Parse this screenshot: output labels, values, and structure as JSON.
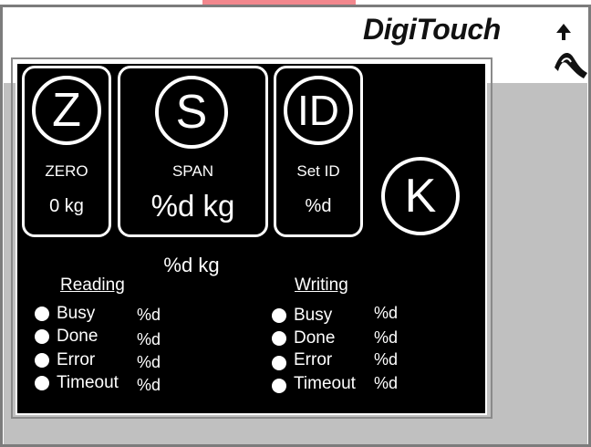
{
  "logo": {
    "text": "DigiTouch"
  },
  "cards": {
    "zero": {
      "symbol": "Z",
      "label": "ZERO",
      "value": "0 kg"
    },
    "span": {
      "symbol": "S",
      "label": "SPAN",
      "value": "%d kg"
    },
    "setid": {
      "symbol": "ID",
      "label": "Set ID",
      "value": "%d"
    }
  },
  "k_button": {
    "symbol": "K"
  },
  "weight_reading": "%d kg",
  "reading": {
    "title": "Reading",
    "rows": [
      {
        "label": "Busy",
        "value": "%d"
      },
      {
        "label": "Done",
        "value": "%d"
      },
      {
        "label": "Error",
        "value": "%d"
      },
      {
        "label": "Timeout",
        "value": "%d"
      }
    ]
  },
  "writing": {
    "title": "Writing",
    "rows": [
      {
        "label": "Busy",
        "value": "%d"
      },
      {
        "label": "Done",
        "value": "%d"
      },
      {
        "label": "Error",
        "value": "%d"
      },
      {
        "label": "Timeout",
        "value": "%d"
      }
    ]
  },
  "colors": {
    "panel": "#000000",
    "background_gray": "#c0c0c0",
    "accent_tab": "#f2878d"
  }
}
